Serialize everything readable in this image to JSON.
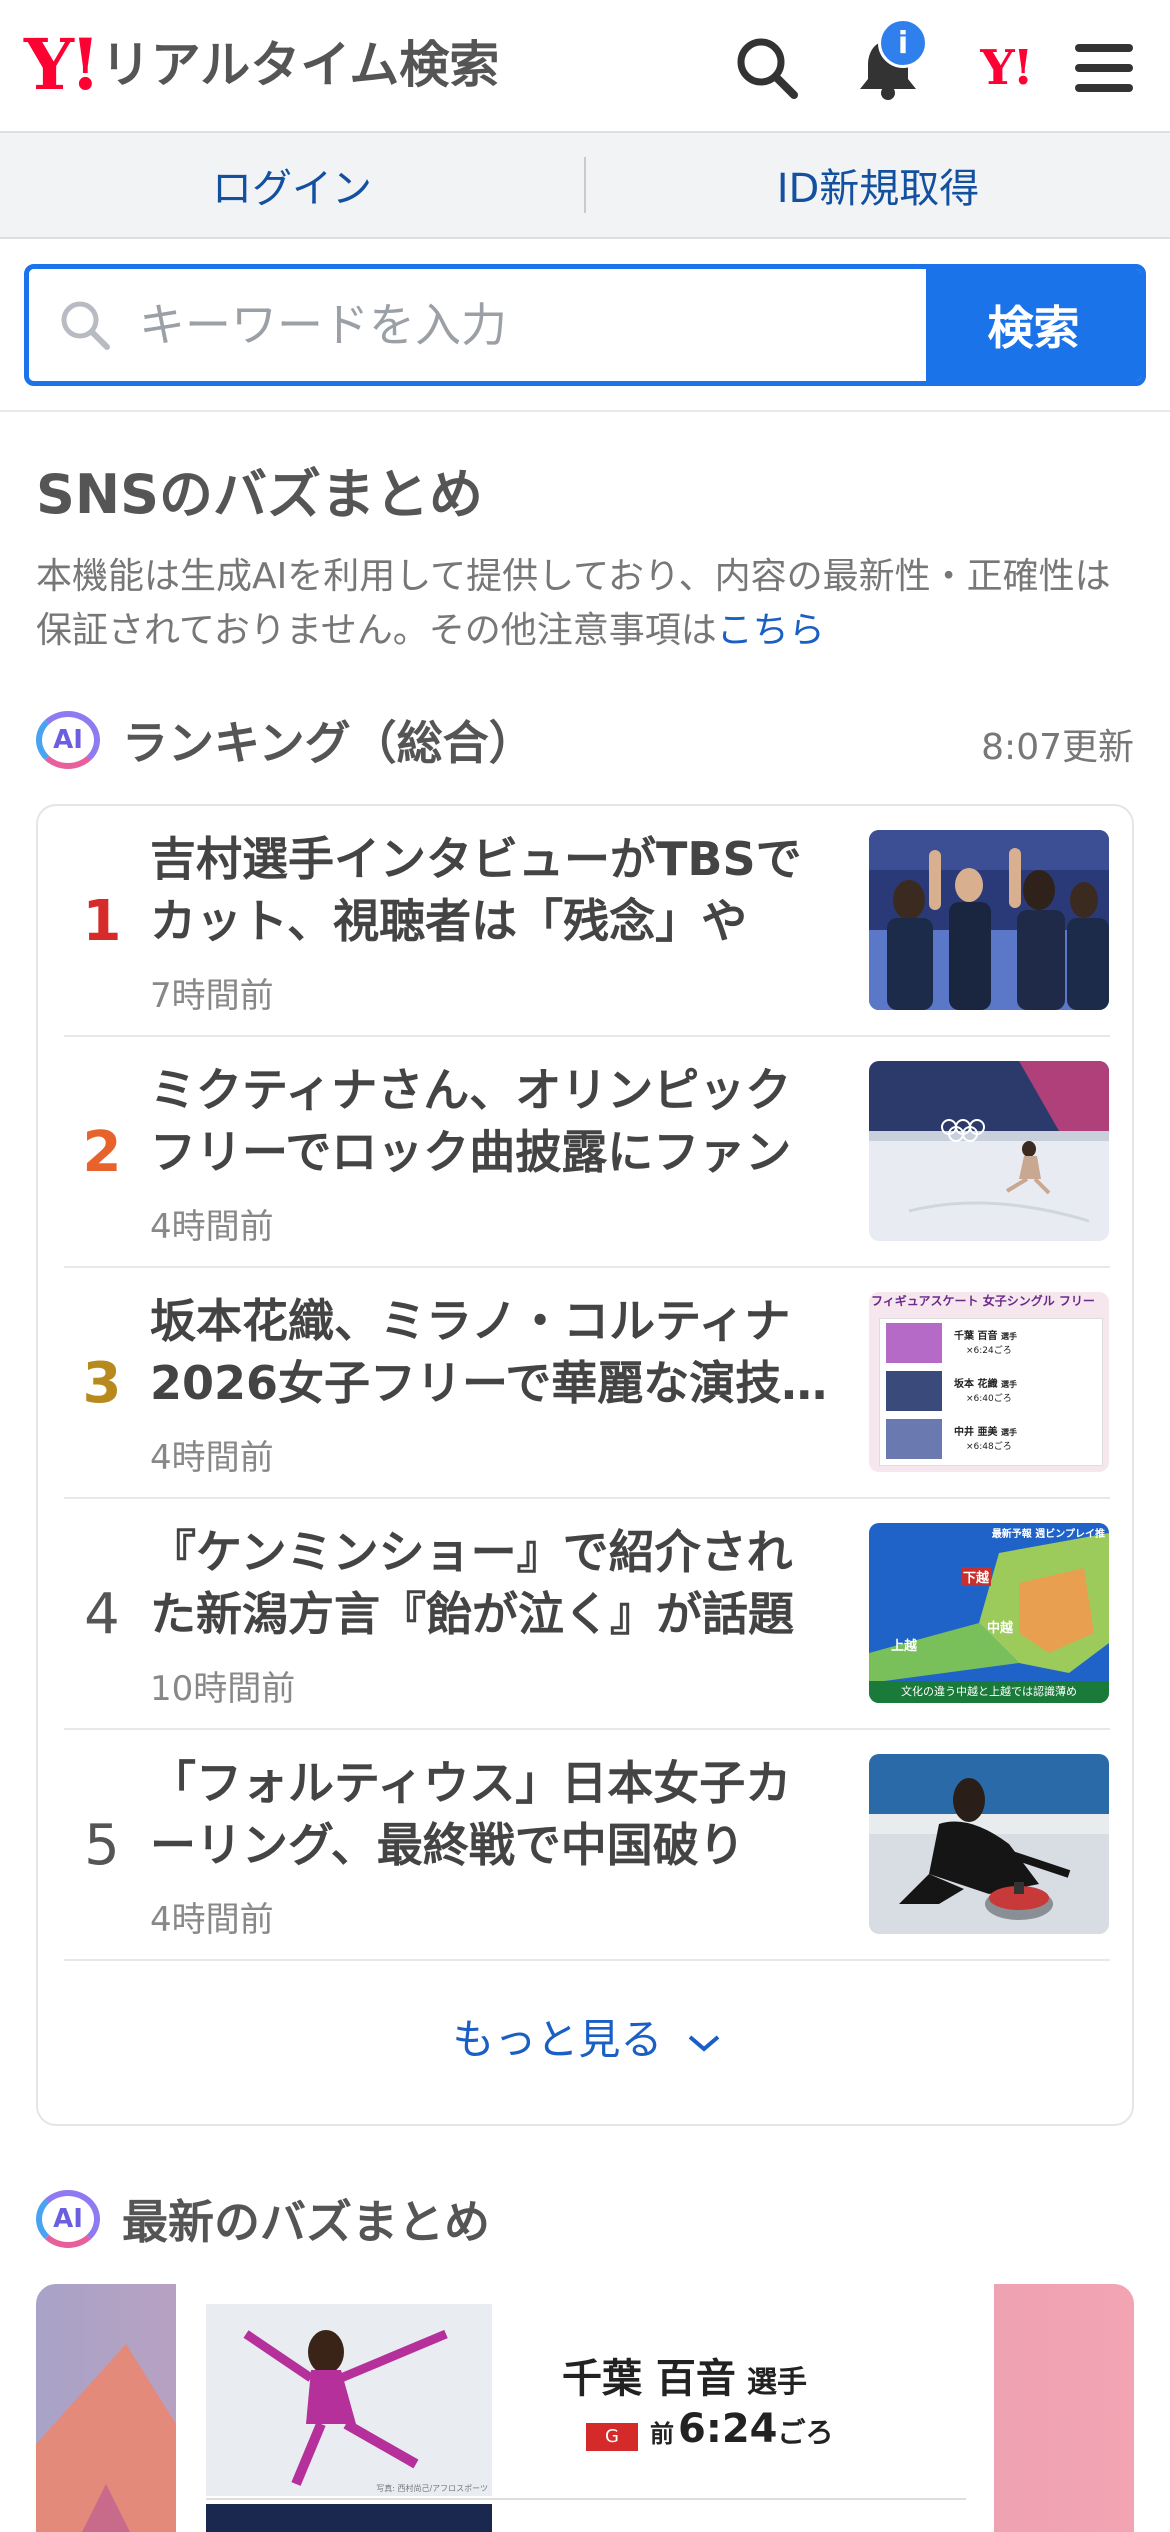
{
  "header": {
    "logo_mark": "Y!",
    "logo_text": "リアルタイム検索",
    "notification_badge": "i",
    "yahoo_mark": "Y!"
  },
  "login_bar": {
    "login": "ログイン",
    "register": "ID新規取得"
  },
  "search": {
    "placeholder": "キーワードを入力",
    "button": "検索"
  },
  "sns": {
    "title": "SNSのバズまとめ",
    "notice": "本機能は生成AIを利用して提供しており、内容の最新性・正確性は保証されておりません。その他注意事項は",
    "notice_link": "こちら"
  },
  "ranking": {
    "ai_label": "AI",
    "title": "ランキング（総合）",
    "updated": "8:07更新",
    "items": [
      {
        "rank": "1",
        "headline": "吉村選手インタビューがTBSでカット、視聴者は「残念」や「酷…",
        "time": "7時間前"
      },
      {
        "rank": "2",
        "headline": "ミクティナさん、オリンピックフリーでロック曲披露にファン歓…",
        "time": "4時間前"
      },
      {
        "rank": "3",
        "headline": "坂本花織、ミラノ・コルティナ2026女子フリーで華麗な演技…",
        "time": "4時間前"
      },
      {
        "rank": "4",
        "headline": "『ケンミンショー』で紹介された新潟方言『飴が泣く』が話題に…",
        "time": "10時間前"
      },
      {
        "rank": "5",
        "headline": "「フォルティウス」日本女子カーリング、最終戦で中国破り「や…",
        "time": "4時間前"
      }
    ],
    "more": "もっと見る"
  },
  "latest": {
    "ai_label": "AI",
    "title": "最新のバズまとめ",
    "athlete_name": "千葉 百音",
    "athlete_suffix": "選手",
    "group": "G",
    "time_prefix": "前",
    "time": "6:24",
    "time_suffix": "ごろ",
    "photo_credit": "写真: 西村尚己/アフロスポーツ"
  },
  "thumb4": {
    "caption_top": "最新予報 週ビンプレイ推",
    "label_shimoetsu": "下越",
    "label_chuetsu": "中越",
    "label_joetsu": "上越",
    "caption_bottom": "文化の違う中越と上越では認識薄め"
  },
  "thumb3": {
    "title": "フィギュアスケート 女子シングル フリー",
    "rows": [
      {
        "name": "千葉 百音",
        "suffix": "選手",
        "time": "×6:24ごろ"
      },
      {
        "name": "坂本 花織",
        "suffix": "選手",
        "time": "×6:40ごろ"
      },
      {
        "name": "中井 亜美",
        "suffix": "選手",
        "time": "×6:48ごろ"
      }
    ]
  },
  "colors": {
    "brand_red": "#ff0033",
    "accent_blue": "#1a73e8",
    "rank1": "#d72a2a",
    "rank2": "#e8632b",
    "rank3": "#b88a1d"
  }
}
